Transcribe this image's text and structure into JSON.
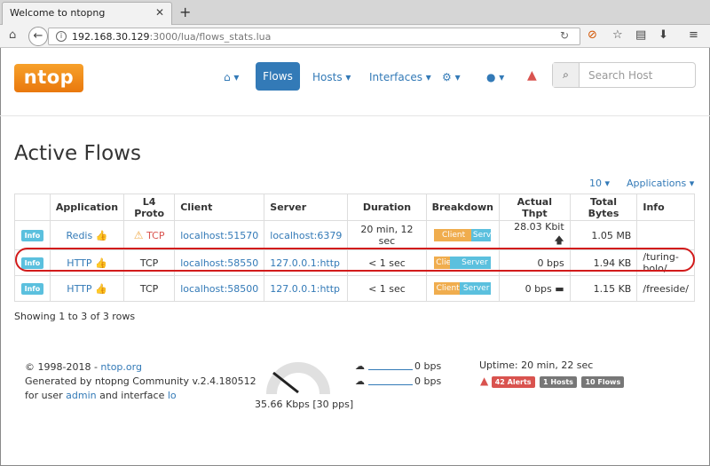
{
  "browser": {
    "tab_title": "Welcome to ntopng",
    "url_host": "192.168.30.129",
    "url_rest": ":3000/lua/flows_stats.lua"
  },
  "nav": {
    "logo": "ntop",
    "flows": "Flows",
    "hosts": "Hosts ▾",
    "interfaces": "Interfaces ▾",
    "search_placeholder": "Search Host"
  },
  "page": {
    "title": "Active Flows",
    "rows_select": "10 ▾",
    "applications_select": "Applications ▾"
  },
  "table": {
    "headers": [
      "Application",
      "L4 Proto",
      "Client",
      "Server",
      "Duration",
      "Breakdown",
      "Actual Thpt",
      "Total Bytes",
      "Info"
    ],
    "rows": [
      {
        "info_btn": "Info",
        "app": "Redis",
        "proto": "TCP",
        "client": "localhost:51570",
        "server": "localhost:6379",
        "duration": "20 min, 12 sec",
        "bd_client": "Client",
        "bd_server": "Server",
        "client_pct": 65,
        "thpt": "28.03 Kbit",
        "bytes": "1.05 MB",
        "info": ""
      },
      {
        "info_btn": "Info",
        "app": "HTTP",
        "proto": "TCP",
        "client": "localhost:58550",
        "server": "127.0.0.1:http",
        "duration": "< 1 sec",
        "bd_client": "Client",
        "bd_server": "Server",
        "client_pct": 27,
        "thpt": "0 bps",
        "bytes": "1.94 KB",
        "info": "/turing-bolo/"
      },
      {
        "info_btn": "Info",
        "app": "HTTP",
        "proto": "TCP",
        "client": "localhost:58500",
        "server": "127.0.0.1:http",
        "duration": "< 1 sec",
        "bd_client": "Client",
        "bd_server": "Server",
        "client_pct": 45,
        "thpt": "0 bps",
        "bytes": "1.15 KB",
        "info": "/freeside/"
      }
    ],
    "showing": "Showing 1 to 3 of 3 rows"
  },
  "footer": {
    "copyright": "© 1998-2018 - ",
    "org_link": "ntop.org",
    "generated": "Generated by ntopng Community v.2.4.180512",
    "for_user": "for user ",
    "user": "admin",
    "and_interface": " and interface ",
    "iface": "lo",
    "gauge_label": "35.66 Kbps [30 pps]",
    "upload_rate": "0 bps",
    "download_rate": "0 bps",
    "uptime": "Uptime: 20 min, 22 sec",
    "alerts": "42 Alerts",
    "hosts": "1 Hosts",
    "flows": "10 Flows"
  },
  "colors": {
    "accent": "#337ab7",
    "logo": "#f39c12",
    "alert": "#d9534f",
    "highlight": "#d21b1b"
  }
}
